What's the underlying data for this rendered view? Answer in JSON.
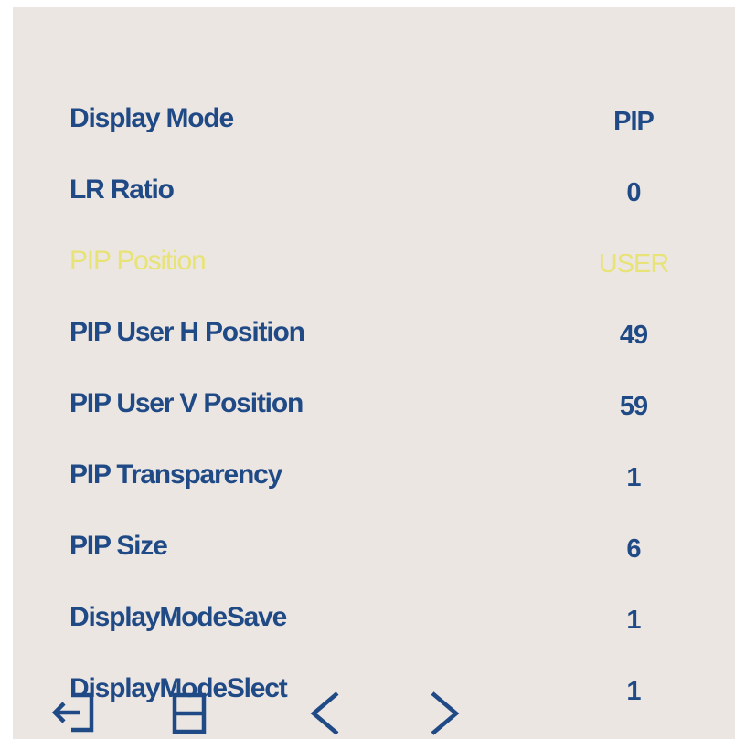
{
  "menu": {
    "items": [
      {
        "label": "Display Mode",
        "value": "PIP"
      },
      {
        "label": "LR Ratio",
        "value": "0"
      },
      {
        "label": "PIP Position",
        "value": "USER",
        "selected": true
      },
      {
        "label": "PIP User H Position",
        "value": "49"
      },
      {
        "label": "PIP User V Position",
        "value": "59"
      },
      {
        "label": "PIP Transparency",
        "value": "1"
      },
      {
        "label": "PIP Size",
        "value": "6"
      },
      {
        "label": "DisplayModeSave",
        "value": "1"
      },
      {
        "label": "DisplayModeSlect",
        "value": "1"
      }
    ]
  },
  "nav": {
    "buttons": [
      {
        "icon": "exit-icon"
      },
      {
        "icon": "menu-icon"
      },
      {
        "icon": "chevron-left-icon"
      },
      {
        "icon": "chevron-right-icon"
      }
    ]
  },
  "colors": {
    "background": "#ece6e3",
    "text": "#1f4a86",
    "highlight": "#e7e36b"
  }
}
